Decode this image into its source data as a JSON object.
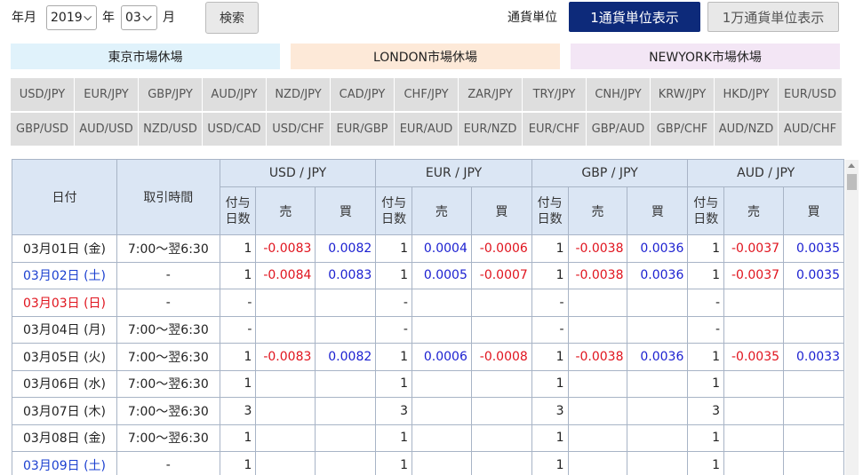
{
  "controls": {
    "year_label": "年月",
    "year_value": "2019",
    "year_unit": "年",
    "month_value": "03",
    "month_unit": "月",
    "search_label": "検索",
    "unit_label": "通貨単位",
    "unit_btn1": "1通貨単位表示",
    "unit_btn2": "1万通貨単位表示"
  },
  "legend": {
    "tokyo": "東京市場休場",
    "london": "LONDON市場休場",
    "newyork": "NEWYORK市場休場",
    "colors": {
      "tokyo": "#e0f2fb",
      "london": "#fde9d8",
      "newyork": "#f3e6f5"
    }
  },
  "pairs_row1": [
    "USD/JPY",
    "EUR/JPY",
    "GBP/JPY",
    "AUD/JPY",
    "NZD/JPY",
    "CAD/JPY",
    "CHF/JPY",
    "ZAR/JPY",
    "TRY/JPY",
    "CNH/JPY",
    "KRW/JPY",
    "HKD/JPY",
    "EUR/USD"
  ],
  "pairs_row2": [
    "GBP/USD",
    "AUD/USD",
    "NZD/USD",
    "USD/CAD",
    "USD/CHF",
    "EUR/GBP",
    "EUR/AUD",
    "EUR/NZD",
    "EUR/CHF",
    "GBP/AUD",
    "GBP/CHF",
    "AUD/NZD",
    "AUD/CHF"
  ],
  "table": {
    "col_date": "日付",
    "col_time": "取引時間",
    "currencies": [
      "USD / JPY",
      "EUR / JPY",
      "GBP / JPY",
      "AUD / JPY"
    ],
    "sub_days": "付与日数",
    "sub_days_l1": "付与",
    "sub_days_l2": "日数",
    "sub_sell": "売",
    "sub_buy": "買",
    "rows": [
      {
        "date": "03月01日 (金)",
        "dtype": "",
        "time": "7:00～翌6:30",
        "c": [
          [
            "1",
            "-0.0083",
            "0.0082"
          ],
          [
            "1",
            "0.0004",
            "-0.0006"
          ],
          [
            "1",
            "-0.0038",
            "0.0036"
          ],
          [
            "1",
            "-0.0037",
            "0.0035"
          ]
        ]
      },
      {
        "date": "03月02日 (土)",
        "dtype": "sat",
        "time": "-",
        "c": [
          [
            "1",
            "-0.0084",
            "0.0083"
          ],
          [
            "1",
            "0.0005",
            "-0.0007"
          ],
          [
            "1",
            "-0.0038",
            "0.0036"
          ],
          [
            "1",
            "-0.0037",
            "0.0035"
          ]
        ]
      },
      {
        "date": "03月03日 (日)",
        "dtype": "sun",
        "time": "-",
        "c": [
          [
            "-",
            "",
            ""
          ],
          [
            "-",
            "",
            ""
          ],
          [
            "-",
            "",
            ""
          ],
          [
            "-",
            "",
            ""
          ]
        ]
      },
      {
        "date": "03月04日 (月)",
        "dtype": "",
        "time": "7:00～翌6:30",
        "c": [
          [
            "-",
            "",
            ""
          ],
          [
            "-",
            "",
            ""
          ],
          [
            "-",
            "",
            ""
          ],
          [
            "-",
            "",
            ""
          ]
        ]
      },
      {
        "date": "03月05日 (火)",
        "dtype": "",
        "time": "7:00～翌6:30",
        "c": [
          [
            "1",
            "-0.0083",
            "0.0082"
          ],
          [
            "1",
            "0.0006",
            "-0.0008"
          ],
          [
            "1",
            "-0.0038",
            "0.0036"
          ],
          [
            "1",
            "-0.0035",
            "0.0033"
          ]
        ]
      },
      {
        "date": "03月06日 (水)",
        "dtype": "",
        "time": "7:00～翌6:30",
        "c": [
          [
            "1",
            "",
            ""
          ],
          [
            "1",
            "",
            ""
          ],
          [
            "1",
            "",
            ""
          ],
          [
            "1",
            "",
            ""
          ]
        ]
      },
      {
        "date": "03月07日 (木)",
        "dtype": "",
        "time": "7:00～翌6:30",
        "c": [
          [
            "3",
            "",
            ""
          ],
          [
            "3",
            "",
            ""
          ],
          [
            "3",
            "",
            ""
          ],
          [
            "3",
            "",
            ""
          ]
        ]
      },
      {
        "date": "03月08日 (金)",
        "dtype": "",
        "time": "7:00～翌6:30",
        "c": [
          [
            "1",
            "",
            ""
          ],
          [
            "1",
            "",
            ""
          ],
          [
            "1",
            "",
            ""
          ],
          [
            "1",
            "",
            ""
          ]
        ]
      },
      {
        "date": "03月09日 (土)",
        "dtype": "sat",
        "time": "-",
        "c": [
          [
            "1",
            "",
            ""
          ],
          [
            "1",
            "",
            ""
          ],
          [
            "1",
            "",
            ""
          ],
          [
            "1",
            "",
            ""
          ]
        ]
      }
    ]
  }
}
